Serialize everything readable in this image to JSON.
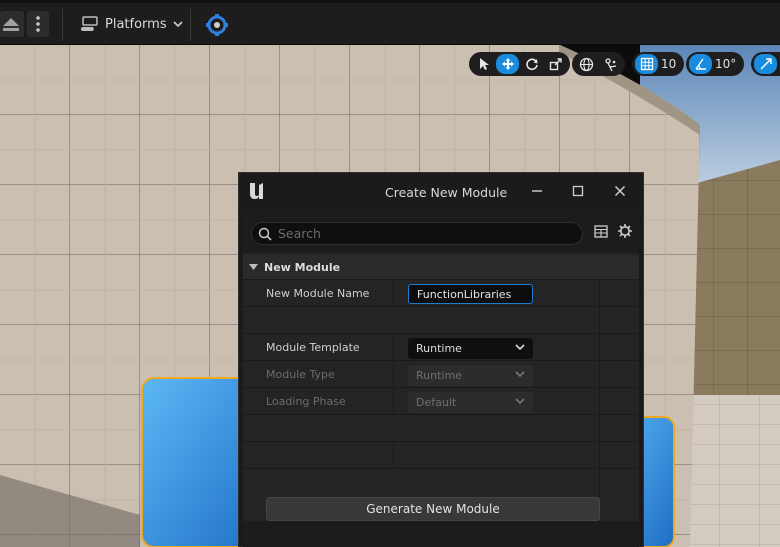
{
  "toolbar": {
    "platforms_label": "Platforms",
    "icons": [
      "eject-icon",
      "more-options-icon",
      "platforms-icon",
      "chevron-down-icon",
      "blueprint-icon"
    ]
  },
  "viewport_toolbar": {
    "grid_snap_value": "10",
    "rotation_snap_value": "10°",
    "icons": [
      "select-tool-icon",
      "translate-tool-icon",
      "rotate-tool-icon",
      "scale-tool-icon",
      "world-space-icon",
      "surface-snap-icon",
      "grid-snap-icon",
      "angle-snap-icon",
      "scale-snap-icon"
    ]
  },
  "dialog": {
    "title": "Create New Module",
    "search_placeholder": "Search",
    "section_title": "New Module",
    "fields": {
      "module_name_label": "New Module Name",
      "module_name_value": "FunctionLibraries",
      "module_template_label": "Module Template",
      "module_template_value": "Runtime",
      "module_type_label": "Module Type",
      "module_type_value": "Runtime",
      "loading_phase_label": "Loading Phase",
      "loading_phase_value": "Default"
    },
    "generate_button": "Generate New Module"
  },
  "colors": {
    "accent": "#1a8ce0",
    "selection_outline": "#f0a820",
    "cube_blue": "#2a8fe0"
  }
}
